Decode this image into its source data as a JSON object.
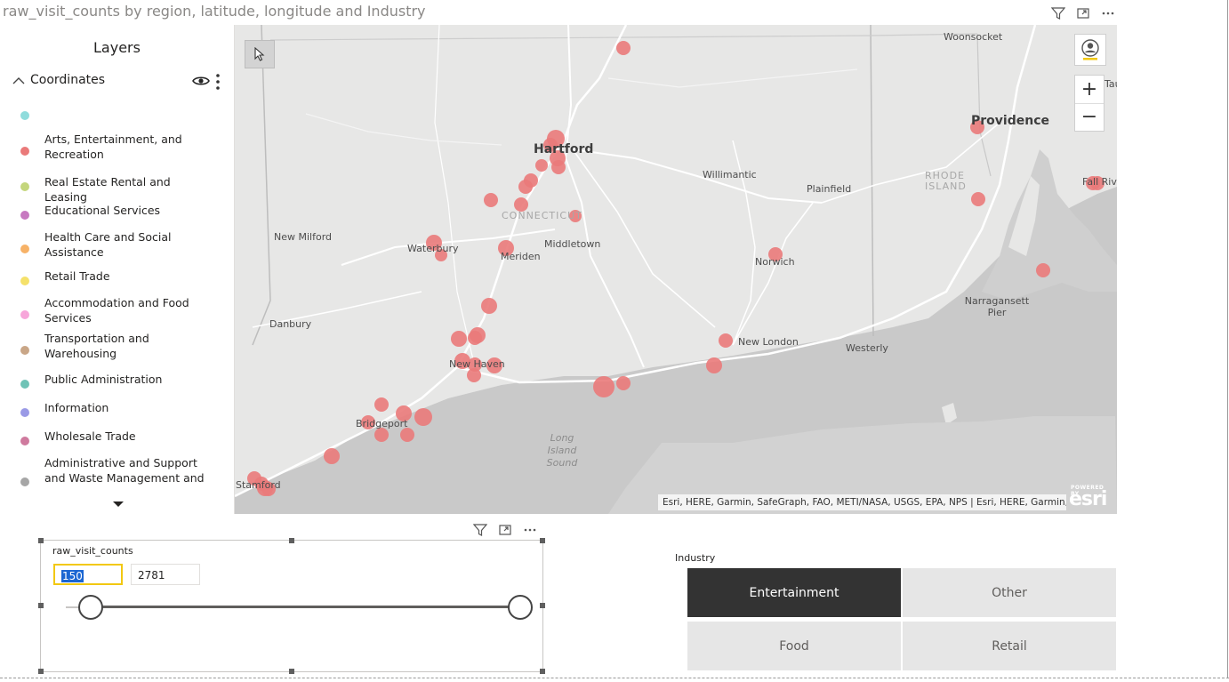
{
  "map_visual": {
    "title": "raw_visit_counts by region, latitude, longitude and Industry",
    "layers_panel": {
      "title": "Layers",
      "layer_name": "Coordinates",
      "legend": [
        {
          "label": "",
          "color": "#8fdcdc"
        },
        {
          "label": "Arts, Entertainment, and Recreation",
          "color": "#ea7a7a"
        },
        {
          "label": "Real Estate Rental and Leasing",
          "color": "#c4d67c"
        },
        {
          "label": "Educational Services",
          "color": "#c779c0"
        },
        {
          "label": "Health Care and Social Assistance",
          "color": "#f7b267"
        },
        {
          "label": "Retail Trade",
          "color": "#f5e16a"
        },
        {
          "label": "Accommodation and Food Services",
          "color": "#f7a6da"
        },
        {
          "label": "Transportation and Warehousing",
          "color": "#c9a687"
        },
        {
          "label": "Public Administration",
          "color": "#6fc3b6"
        },
        {
          "label": "Information",
          "color": "#9a9ae6"
        },
        {
          "label": "Wholesale Trade",
          "color": "#cf7a9e"
        },
        {
          "label": "Administrative and Support and Waste Management and Remediation Services",
          "color": "#a6a6a6"
        }
      ]
    },
    "map": {
      "point_color": "#ea7a7a",
      "labels": {
        "woonsocket": "Woonsocket",
        "providence": "Providence",
        "hartford": "Hartford",
        "willimantic": "Willimantic",
        "plainfield": "Plainfield",
        "rhode_island": "RHODE ISLAND",
        "connecticut": "CONNECTICUT",
        "new_milford": "New Milford",
        "waterbury": "Waterbury",
        "meriden": "Meriden",
        "middletown": "Middletown",
        "norwich": "Norwich",
        "fall_river": "Fall Rive",
        "taunton": "Tau",
        "narragansett_pier": "Narragansett Pier",
        "danbury": "Danbury",
        "new_london": "New London",
        "westerly": "Westerly",
        "new_haven": "New Haven",
        "bridgeport": "Bridgeport",
        "long_island_sound": "Long Island Sound",
        "stamford": "Stamford"
      },
      "zoom_in": "+",
      "zoom_out": "−",
      "attribution": "Esri, HERE, Garmin, SafeGraph, FAO, METI/NASA, USGS, EPA, NPS | Esri, HERE, Garmin, Safe...",
      "logo_powered": "POWERED BY",
      "logo_text": "esri"
    }
  },
  "slider_visual": {
    "title": "raw_visit_counts",
    "min_value": "150",
    "max_value": "2781"
  },
  "industry_slicer": {
    "title": "Industry",
    "options": [
      {
        "label": "Entertainment",
        "selected": true
      },
      {
        "label": "Other",
        "selected": false
      },
      {
        "label": "Food",
        "selected": false
      },
      {
        "label": "Retail",
        "selected": false
      }
    ]
  }
}
